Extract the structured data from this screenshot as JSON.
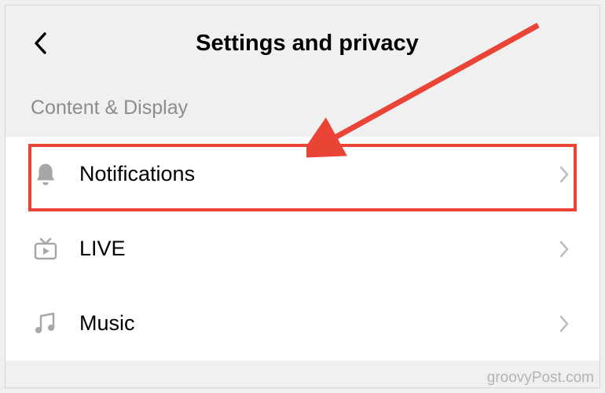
{
  "header": {
    "title": "Settings and privacy"
  },
  "section": {
    "label": "Content & Display"
  },
  "rows": [
    {
      "icon": "bell-icon",
      "label": "Notifications"
    },
    {
      "icon": "tv-icon",
      "label": "LIVE"
    },
    {
      "icon": "music-icon",
      "label": "Music"
    }
  ],
  "annotation": {
    "highlight_color": "#ea4437"
  },
  "watermark": "groovyPost.com"
}
